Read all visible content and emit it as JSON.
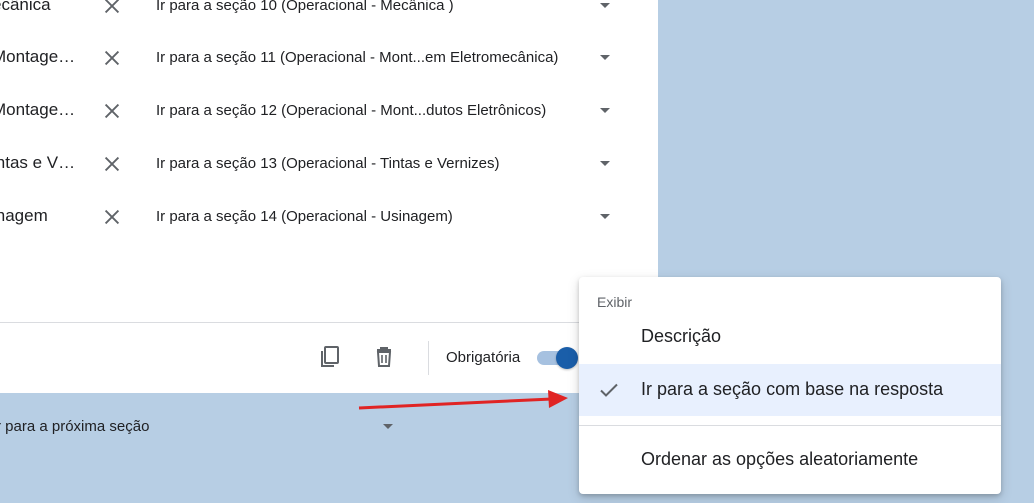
{
  "options": [
    {
      "label": "ecânica",
      "nav": "Ir para a seção 10 (Operacional - Mecânica )"
    },
    {
      "label": "Montage…",
      "nav": "Ir para a seção 11 (Operacional - Mont...em Eletromecânica)"
    },
    {
      "label": "Montage…",
      "nav": "Ir para a seção 12 (Operacional - Mont...dutos Eletrônicos)"
    },
    {
      "label": "intas e V…",
      "nav": "Ir para a seção 13 (Operacional - Tintas e Vernizes)"
    },
    {
      "label": "inagem",
      "nav": "Ir para a seção 14 (Operacional - Usinagem)"
    }
  ],
  "footer": {
    "duplicate_icon": "copy-icon",
    "delete_icon": "trash-icon",
    "required_label": "Obrigatória",
    "required_on": true
  },
  "after_section": {
    "value": "r para a próxima seção"
  },
  "menu": {
    "header": "Exibir",
    "items": [
      {
        "label": "Descrição",
        "checked": false
      },
      {
        "label": "Ir para a seção com base na resposta",
        "checked": true
      },
      {
        "label": "Ordenar as opções aleatoriamente",
        "checked": false
      }
    ]
  },
  "colors": {
    "background": "#b7cee4",
    "toggle_on": "#1a5ea9",
    "menu_highlight": "#e8f0fe",
    "annotation_arrow": "#e02424"
  }
}
